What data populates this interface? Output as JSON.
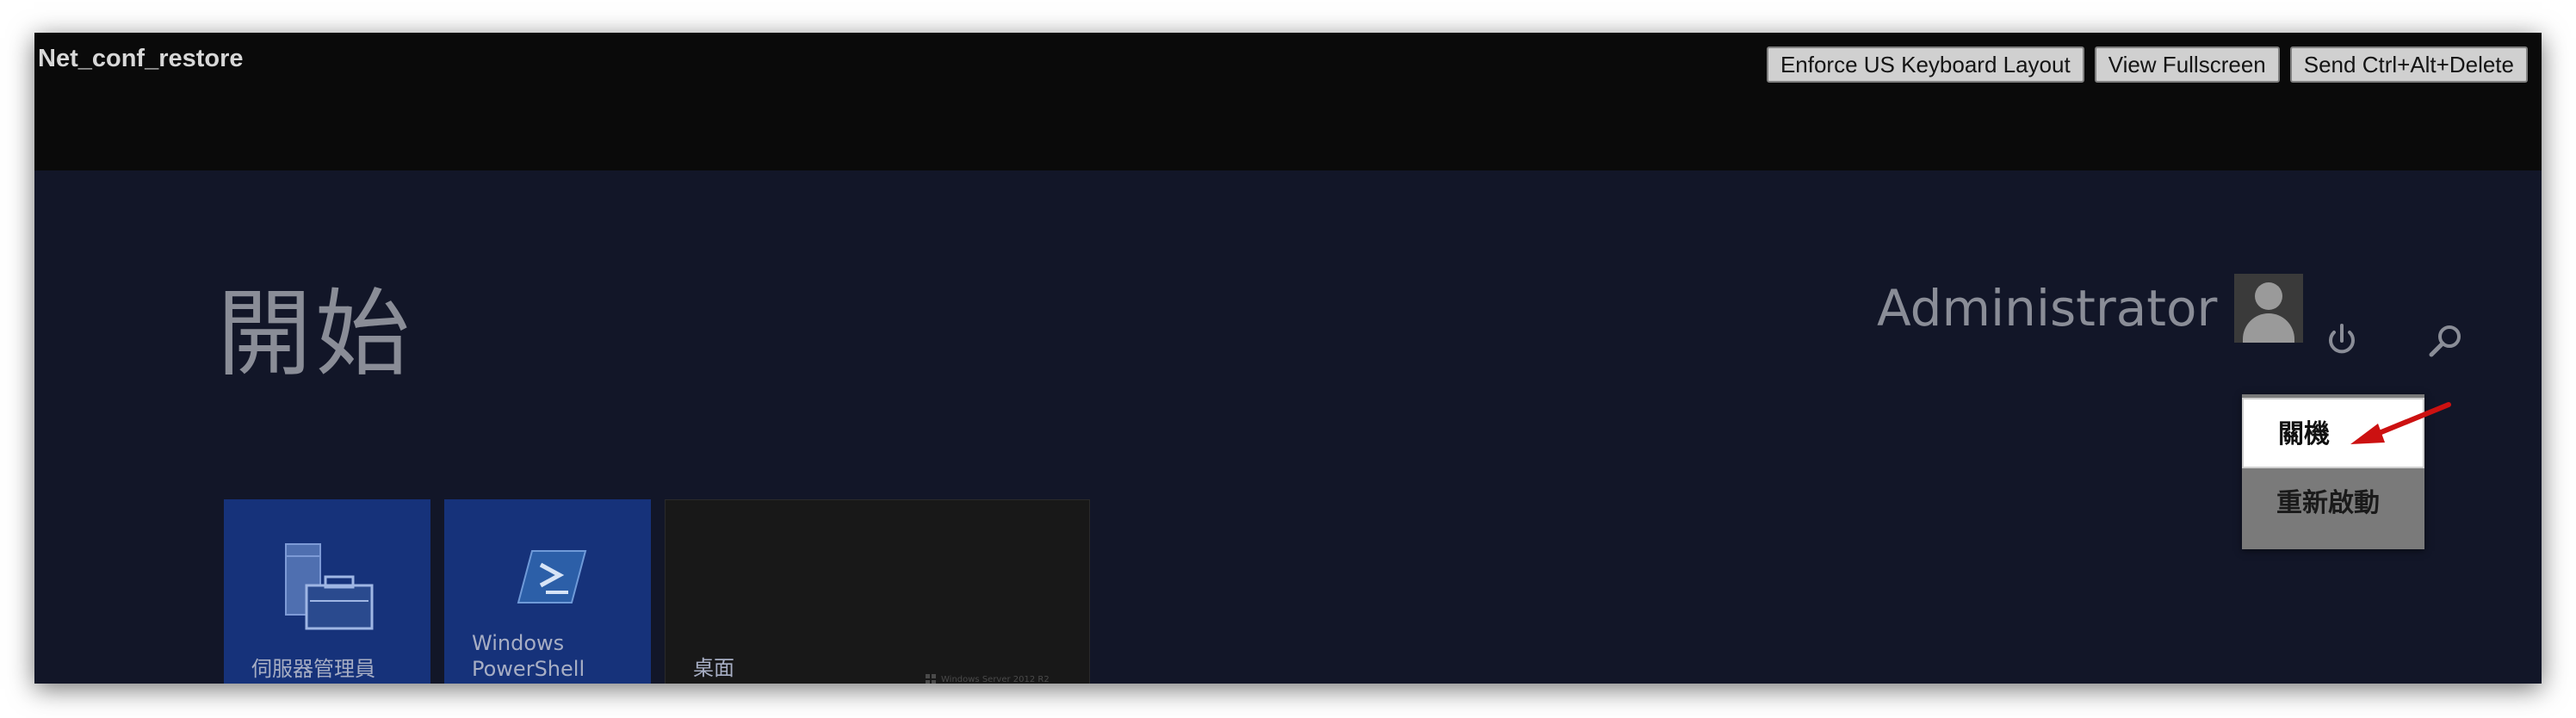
{
  "vm": {
    "title": "Net_conf_restore",
    "buttons": {
      "keyboard": "Enforce US Keyboard Layout",
      "fullscreen": "View Fullscreen",
      "ctrl_alt_del": "Send Ctrl+Alt+Delete"
    }
  },
  "start_screen": {
    "heading": "開始",
    "user": "Administrator",
    "icons": [
      "avatar",
      "power-icon",
      "search-icon"
    ],
    "power_menu": {
      "shutdown": "關機",
      "restart": "重新啟動",
      "highlight_color": "#cc1111"
    },
    "tiles": [
      {
        "label": "伺服器管理員",
        "icon": "server-manager-icon"
      },
      {
        "label_line1": "Windows",
        "label_line2": "PowerShell",
        "icon": "powershell-icon"
      },
      {
        "label": "桌面",
        "icon": "windows-logo-icon",
        "watermark": "Windows Server 2012 R2"
      }
    ]
  },
  "colors": {
    "topbar": "#0a0a0a",
    "start_background": "#121628",
    "tile_blue": "#16327a",
    "tile_dark": "#181818"
  }
}
